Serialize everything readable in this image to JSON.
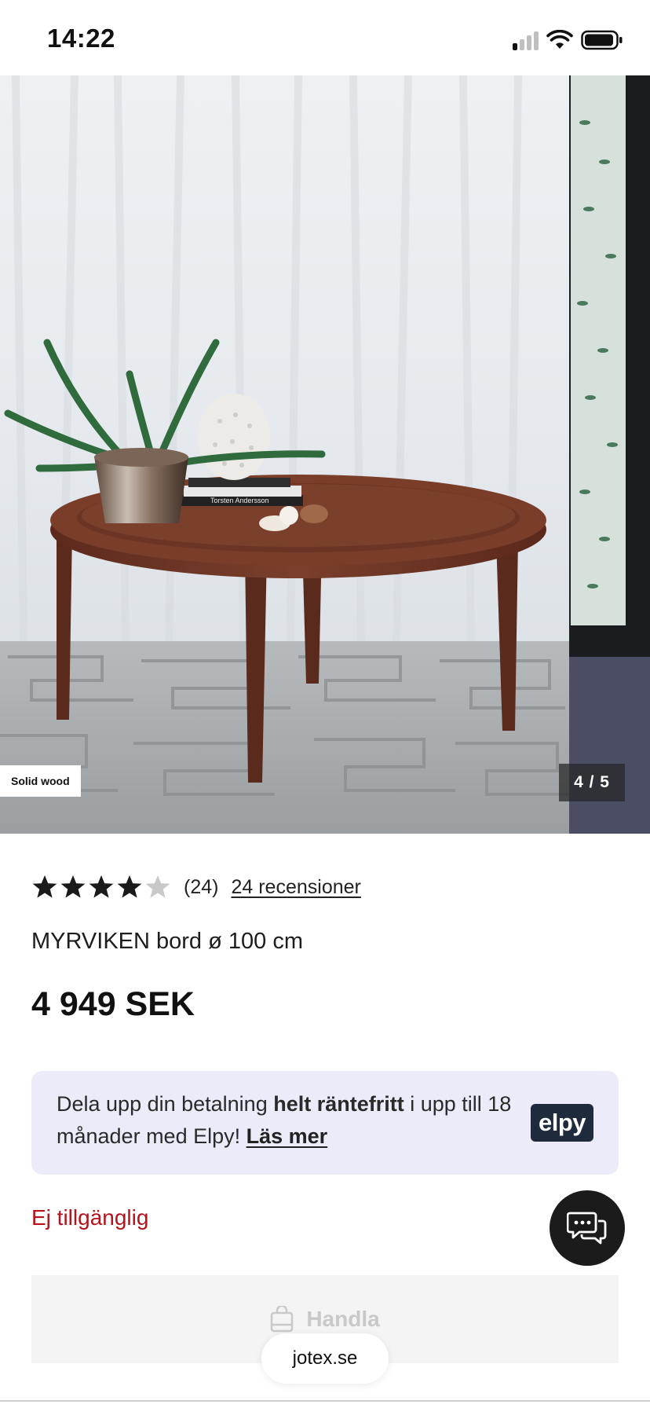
{
  "status_bar": {
    "time": "14:22"
  },
  "gallery": {
    "badge": "Solid wood",
    "counter": "4 / 5",
    "current_index": 4,
    "total": 5,
    "book_text": "Torsten Andersson"
  },
  "product": {
    "rating": 4,
    "rating_max": 5,
    "rating_count": "(24)",
    "reviews_link": "24 recensioner",
    "title": "MYRVIKEN bord ø 100 cm",
    "price": "4 949 SEK",
    "availability": "Ej tillgänglig"
  },
  "payment_banner": {
    "text_1": "Dela upp din betalning ",
    "text_bold": "helt räntefritt",
    "text_2": " i upp till 18 månader med Elpy! ",
    "link": "Läs mer",
    "logo": "elpy"
  },
  "buy_button": {
    "label": "Handla",
    "icon": "shopping-bag-icon",
    "enabled": false
  },
  "chat": {
    "icon": "chat-bubbles-icon"
  },
  "browser": {
    "url": "jotex.se"
  },
  "colors": {
    "accent_red": "#b5121b",
    "banner_bg": "#ebebfa",
    "elpy_logo_bg": "#1f2a3d",
    "wood": "#6e3424"
  }
}
